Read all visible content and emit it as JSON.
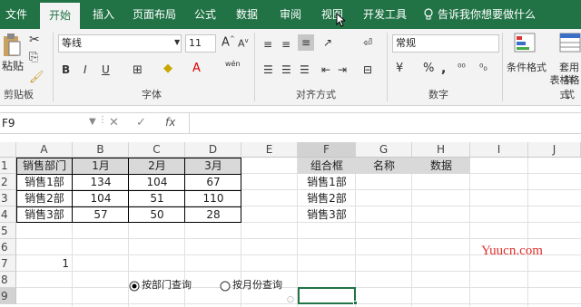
{
  "tabs": {
    "file": "文件",
    "home": "开始",
    "insert": "插入",
    "layout": "页面布局",
    "formulas": "公式",
    "data": "数据",
    "review": "审阅",
    "view": "视图",
    "developer": "开发工具",
    "tellme": "告诉我你想要做什么"
  },
  "ribbon": {
    "paste": "粘贴",
    "clipboard": "剪贴板",
    "font_group": "字体",
    "align_group": "对齐方式",
    "number_group": "数字",
    "styles_group": "样式",
    "font_name": "等线",
    "font_size": "11",
    "bold": "B",
    "italic": "I",
    "underline": "U",
    "font_grow": "A",
    "font_shrink": "A",
    "number_format": "常规",
    "percent": "%",
    "comma": ",",
    "currency": "¥",
    "cond_format": "条件格式",
    "table_format_1": "套用",
    "table_format_2": "表格格式",
    "wen": "wén"
  },
  "formula_bar": {
    "name_box": "F9",
    "fx": "fx",
    "cancel": "✕",
    "enter": "✓"
  },
  "columns": [
    "A",
    "B",
    "C",
    "D",
    "E",
    "F",
    "G",
    "H",
    "I",
    "J"
  ],
  "rows": [
    "1",
    "2",
    "3",
    "4",
    "5",
    "6",
    "7",
    "8",
    "9"
  ],
  "table": {
    "headers": [
      "销售部门",
      "1月",
      "2月",
      "3月"
    ],
    "rows": [
      [
        "销售1部",
        "134",
        "104",
        "67"
      ],
      [
        "销售2部",
        "104",
        "51",
        "110"
      ],
      [
        "销售3部",
        "57",
        "50",
        "28"
      ]
    ]
  },
  "cell_a7": "1",
  "f_header": "组合框",
  "g_header": "名称",
  "h_header": "数据",
  "f_items": [
    "销售1部",
    "销售2部",
    "销售3部"
  ],
  "radio_dept": "按部门查询",
  "radio_month": "按月份查询",
  "watermark": "Yuucn.com"
}
